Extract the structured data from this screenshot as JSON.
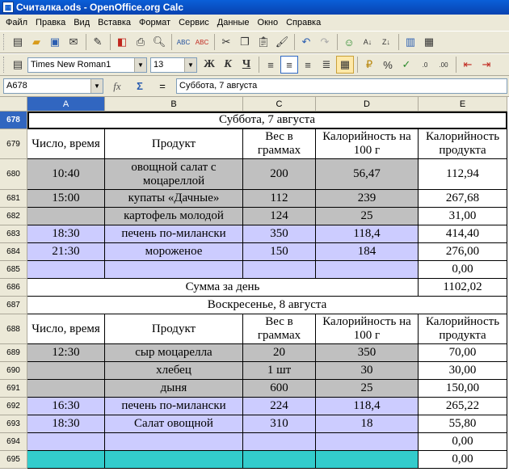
{
  "window": {
    "title": "Считалка.ods - OpenOffice.org Calc"
  },
  "menu": [
    "Файл",
    "Правка",
    "Вид",
    "Вставка",
    "Формат",
    "Сервис",
    "Данные",
    "Окно",
    "Справка"
  ],
  "toolbar": {
    "font_name": "Times New Roman1",
    "font_size": "13",
    "bold_label": "Ж",
    "italic_label": "К",
    "underline_label": "Ч"
  },
  "formula_bar": {
    "name_box": "A678",
    "fx_label": "fx",
    "sigma_label": "Σ",
    "equals_label": "=",
    "content": "Суббота, 7 августа"
  },
  "columns": [
    "A",
    "B",
    "C",
    "D",
    "E"
  ],
  "rows": [
    {
      "num": "678",
      "type": "merged",
      "text": "Суббота, 7 августа"
    },
    {
      "num": "679",
      "type": "header",
      "cells": [
        "Число, время",
        "Продукт",
        "Вес в граммах",
        "Калорийность на 100 г",
        "Калорийность продукта"
      ]
    },
    {
      "num": "680",
      "type": "data",
      "cells": [
        "10:40",
        "овощной салат с моцареллой",
        "200",
        "56,47",
        "112,94"
      ],
      "color": "grey"
    },
    {
      "num": "681",
      "type": "data",
      "cells": [
        "15:00",
        "купаты «Дачные»",
        "112",
        "239",
        "267,68"
      ],
      "color": "grey"
    },
    {
      "num": "682",
      "type": "data",
      "cells": [
        "",
        "картофель молодой",
        "124",
        "25",
        "31,00"
      ],
      "color": "grey"
    },
    {
      "num": "683",
      "type": "data",
      "cells": [
        "18:30",
        "печень по-милански",
        "350",
        "118,4",
        "414,40"
      ],
      "color": "lav"
    },
    {
      "num": "684",
      "type": "data",
      "cells": [
        "21:30",
        "мороженое",
        "150",
        "184",
        "276,00"
      ],
      "color": "lav"
    },
    {
      "num": "685",
      "type": "data",
      "cells": [
        "",
        "",
        "",
        "",
        "0,00"
      ],
      "color": "lav"
    },
    {
      "num": "686",
      "type": "sum",
      "text": "Сумма за день",
      "value": "1102,02"
    },
    {
      "num": "687",
      "type": "merged",
      "text": "Воскресенье, 8 августа"
    },
    {
      "num": "688",
      "type": "header",
      "cells": [
        "Число, время",
        "Продукт",
        "Вес в граммах",
        "Калорийность на 100 г",
        "Калорийность продукта"
      ]
    },
    {
      "num": "689",
      "type": "data",
      "cells": [
        "12:30",
        "сыр моцарелла",
        "20",
        "350",
        "70,00"
      ],
      "color": "grey"
    },
    {
      "num": "690",
      "type": "data",
      "cells": [
        "",
        "хлебец",
        "1 шт",
        "30",
        "30,00"
      ],
      "color": "grey"
    },
    {
      "num": "691",
      "type": "data",
      "cells": [
        "",
        "дыня",
        "600",
        "25",
        "150,00"
      ],
      "color": "grey"
    },
    {
      "num": "692",
      "type": "data",
      "cells": [
        "16:30",
        "печень по-милански",
        "224",
        "118,4",
        "265,22"
      ],
      "color": "lav"
    },
    {
      "num": "693",
      "type": "data",
      "cells": [
        "18:30",
        "Салат овощной",
        "310",
        "18",
        "55,80"
      ],
      "color": "lav"
    },
    {
      "num": "694",
      "type": "data",
      "cells": [
        "",
        "",
        "",
        "",
        "0,00"
      ],
      "color": "lav"
    },
    {
      "num": "695",
      "type": "data",
      "cells": [
        "",
        "",
        "",
        "",
        "0,00"
      ],
      "color": "teal"
    }
  ]
}
